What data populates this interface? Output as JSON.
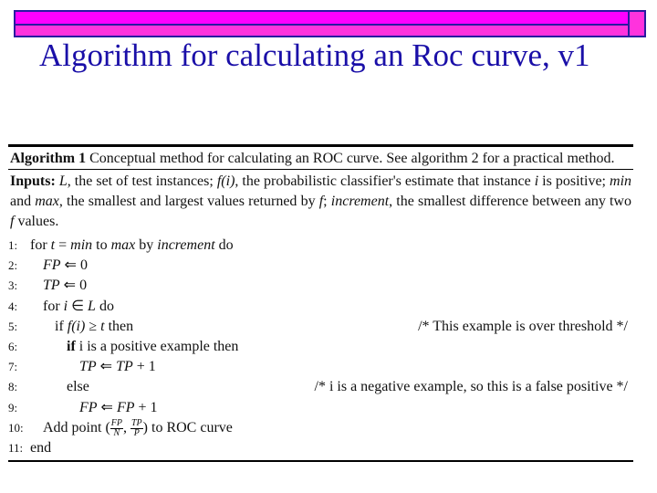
{
  "slide": {
    "title": "Algorithm for calculating an Roc curve, v1",
    "colors": {
      "bar_top": "#ff00ff",
      "bar_bottom": "#ff33dd",
      "bar_border": "#2a1aa0",
      "title": "#1a0fa8"
    }
  },
  "algorithm": {
    "caption_label": "Algorithm 1",
    "caption_text": "Conceptual method for calculating an ROC curve. See algorithm 2 for a practical method.",
    "inputs_label": "Inputs:",
    "inputs_parts": {
      "p1": "L",
      "p2": ", the set of test instances; ",
      "p3": "f(i)",
      "p4": ", the probabilistic classifier's estimate that instance ",
      "p5": "i",
      "p6": " is positive; ",
      "p7": "min",
      "p8": " and ",
      "p9": "max",
      "p10": ", the smallest and largest values returned by ",
      "p11": "f",
      "p12": "; ",
      "p13": "increment",
      "p14": ", the smallest difference between any two ",
      "p15": "f",
      "p16": " values."
    },
    "lines": [
      {
        "num": "1:",
        "kw1": "for ",
        "v1": "t",
        "t1": " = ",
        "v2": "min",
        "t2": " to ",
        "v3": "max",
        "t3": " by ",
        "v4": "increment",
        "t4": " do"
      },
      {
        "num": "2:",
        "v1": "FP",
        "t1": " ⇐ 0"
      },
      {
        "num": "3:",
        "v1": "TP",
        "t1": " ⇐ 0"
      },
      {
        "num": "4:",
        "kw1": "for ",
        "v1": "i",
        "t1": " ∈ ",
        "v2": "L",
        "t2": " do"
      },
      {
        "num": "5:",
        "kw1": "if ",
        "v1": "f(i)",
        "t1": " ≥ ",
        "v2": "t",
        "t2": " then",
        "comment": "/* This example is over threshold */"
      },
      {
        "num": "6:",
        "kw1": "if",
        "t1": " i is a positive example then"
      },
      {
        "num": "7:",
        "v1": "TP",
        "t1": " ⇐ ",
        "v2": "TP",
        "t2": " + 1"
      },
      {
        "num": "8:",
        "t1": "else",
        "comment": "/* i is a negative example, so this is a false positive */"
      },
      {
        "num": "9:",
        "v1": "FP",
        "t1": " ⇐ ",
        "v2": "FP",
        "t2": " + 1"
      },
      {
        "num": "10:",
        "t1": "Add point (",
        "f1n": "FP",
        "f1d": "N",
        "sep": ", ",
        "f2n": "TP",
        "f2d": "P",
        "t2": ") to ROC curve"
      },
      {
        "num": "11:",
        "t1": "end"
      }
    ]
  }
}
